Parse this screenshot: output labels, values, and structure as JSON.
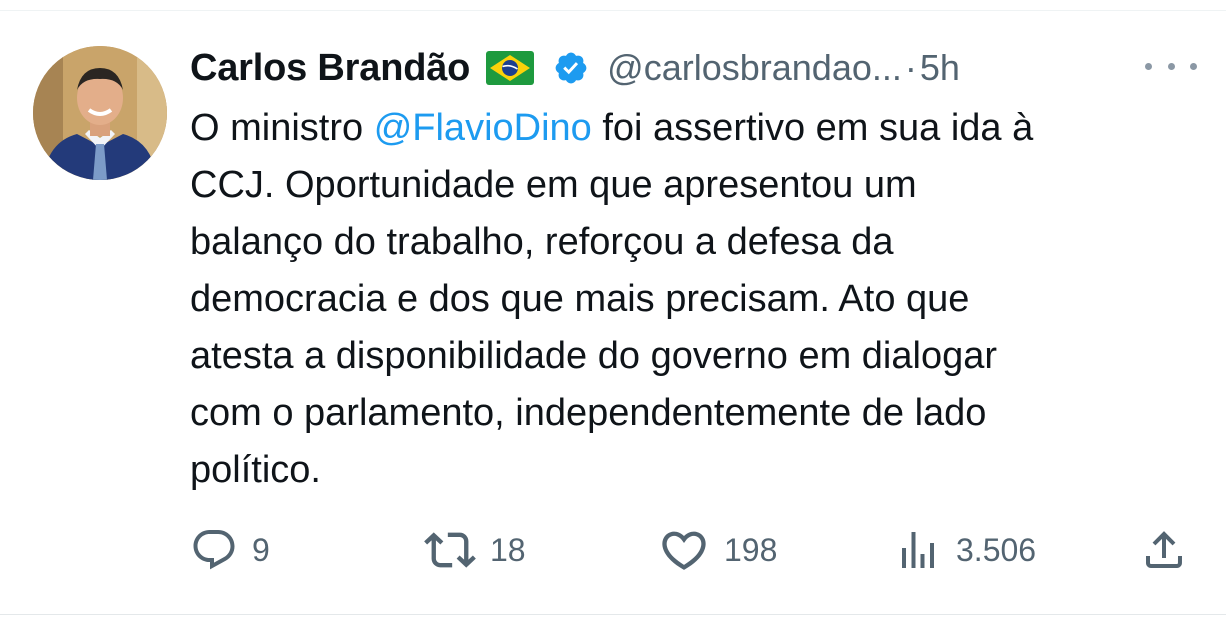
{
  "tweet": {
    "author_name": "Carlos Brandão",
    "author_handle": "@carlosbrandao...",
    "separator": "·",
    "timestamp": "5h",
    "text_lines": [
      {
        "before": "O ministro ",
        "mention": "@FlavioDino",
        "after": " foi assertivo em sua ida à"
      },
      {
        "text": "CCJ. Oportunidade em que apresentou um"
      },
      {
        "text": "balanço do trabalho, reforçou a defesa da"
      },
      {
        "text": "democracia e dos que mais precisam. Ato que"
      },
      {
        "text": "atesta a disponibilidade do governo em dialogar"
      },
      {
        "text": "com o parlamento, independentemente de lado"
      },
      {
        "text": "político."
      }
    ]
  },
  "actions": {
    "replies": "9",
    "retweets": "18",
    "likes": "198",
    "views": "3.506"
  },
  "icons": {
    "flag": "brazil-flag-icon",
    "verified": "verified-badge-icon",
    "more": "more-options-icon",
    "reply": "reply-icon",
    "retweet": "retweet-icon",
    "like": "heart-icon",
    "views": "views-chart-icon",
    "share": "share-icon"
  },
  "colors": {
    "text": "#0f1419",
    "secondary": "#536471",
    "accent": "#1d9bf0"
  }
}
